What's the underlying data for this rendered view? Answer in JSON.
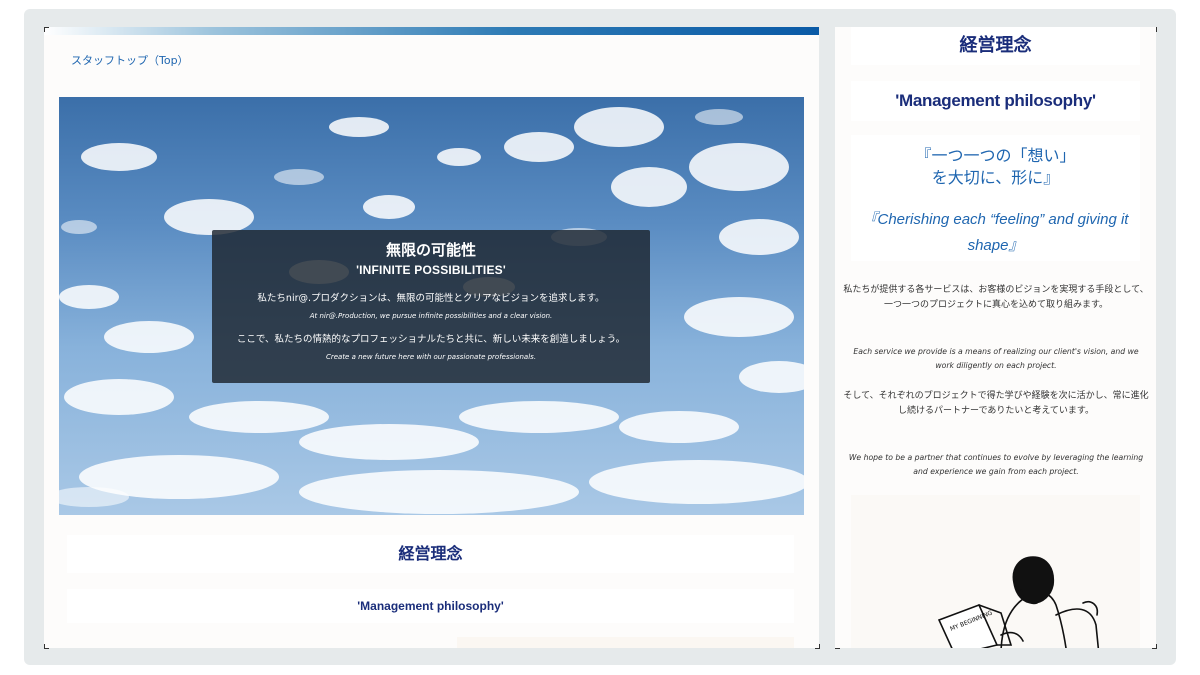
{
  "left": {
    "breadcrumb": "スタッフトップ（Top）",
    "hero": {
      "title": "無限の可能性",
      "subtitle": "'INFINITE POSSIBILITIES'",
      "line1_jp": "私たちnir@.プロダクションは、無限の可能性とクリアなビジョンを追求します。",
      "line1_en": "At nir@.Production, we pursue infinite possibilities and a clear vision.",
      "line2_jp": "ここで、私たちの情熱的なプロフェッショナルたちと共に、新しい未来を創造しましょう。",
      "line2_en": "Create a new future here with our passionate professionals."
    },
    "heading": "経営理念",
    "subheading": "'Management philosophy'"
  },
  "right": {
    "heading": "経営理念",
    "subheading": "'Management philosophy'",
    "quote_jp_line1": "『一つ一つの「想い」",
    "quote_jp_line2": "を大切に、形に』",
    "quote_en": "『Cherishing each “feeling” and giving it shape』",
    "para1_jp": "私たちが提供する各サービスは、お客様のビジョンを実現する手段として、一つ一つのプロジェクトに真心を込めて取り組みます。",
    "para1_en": "Each service we provide is a means of realizing our client's vision, and we work diligently on each project.",
    "para2_jp": "そして、それぞれのプロジェクトで得た学びや経験を次に活かし、常に進化し続けるパートナーでありたいと考えています。",
    "para2_en": "We hope to be a partner that continues to evolve by leveraging the learning and experience we gain from each project.",
    "illustration_book_text": "MY BEGINNING"
  },
  "colors": {
    "heading_navy": "#1a2d7a",
    "link_blue": "#1f66b0",
    "frame_bg": "#e6eaeb"
  }
}
